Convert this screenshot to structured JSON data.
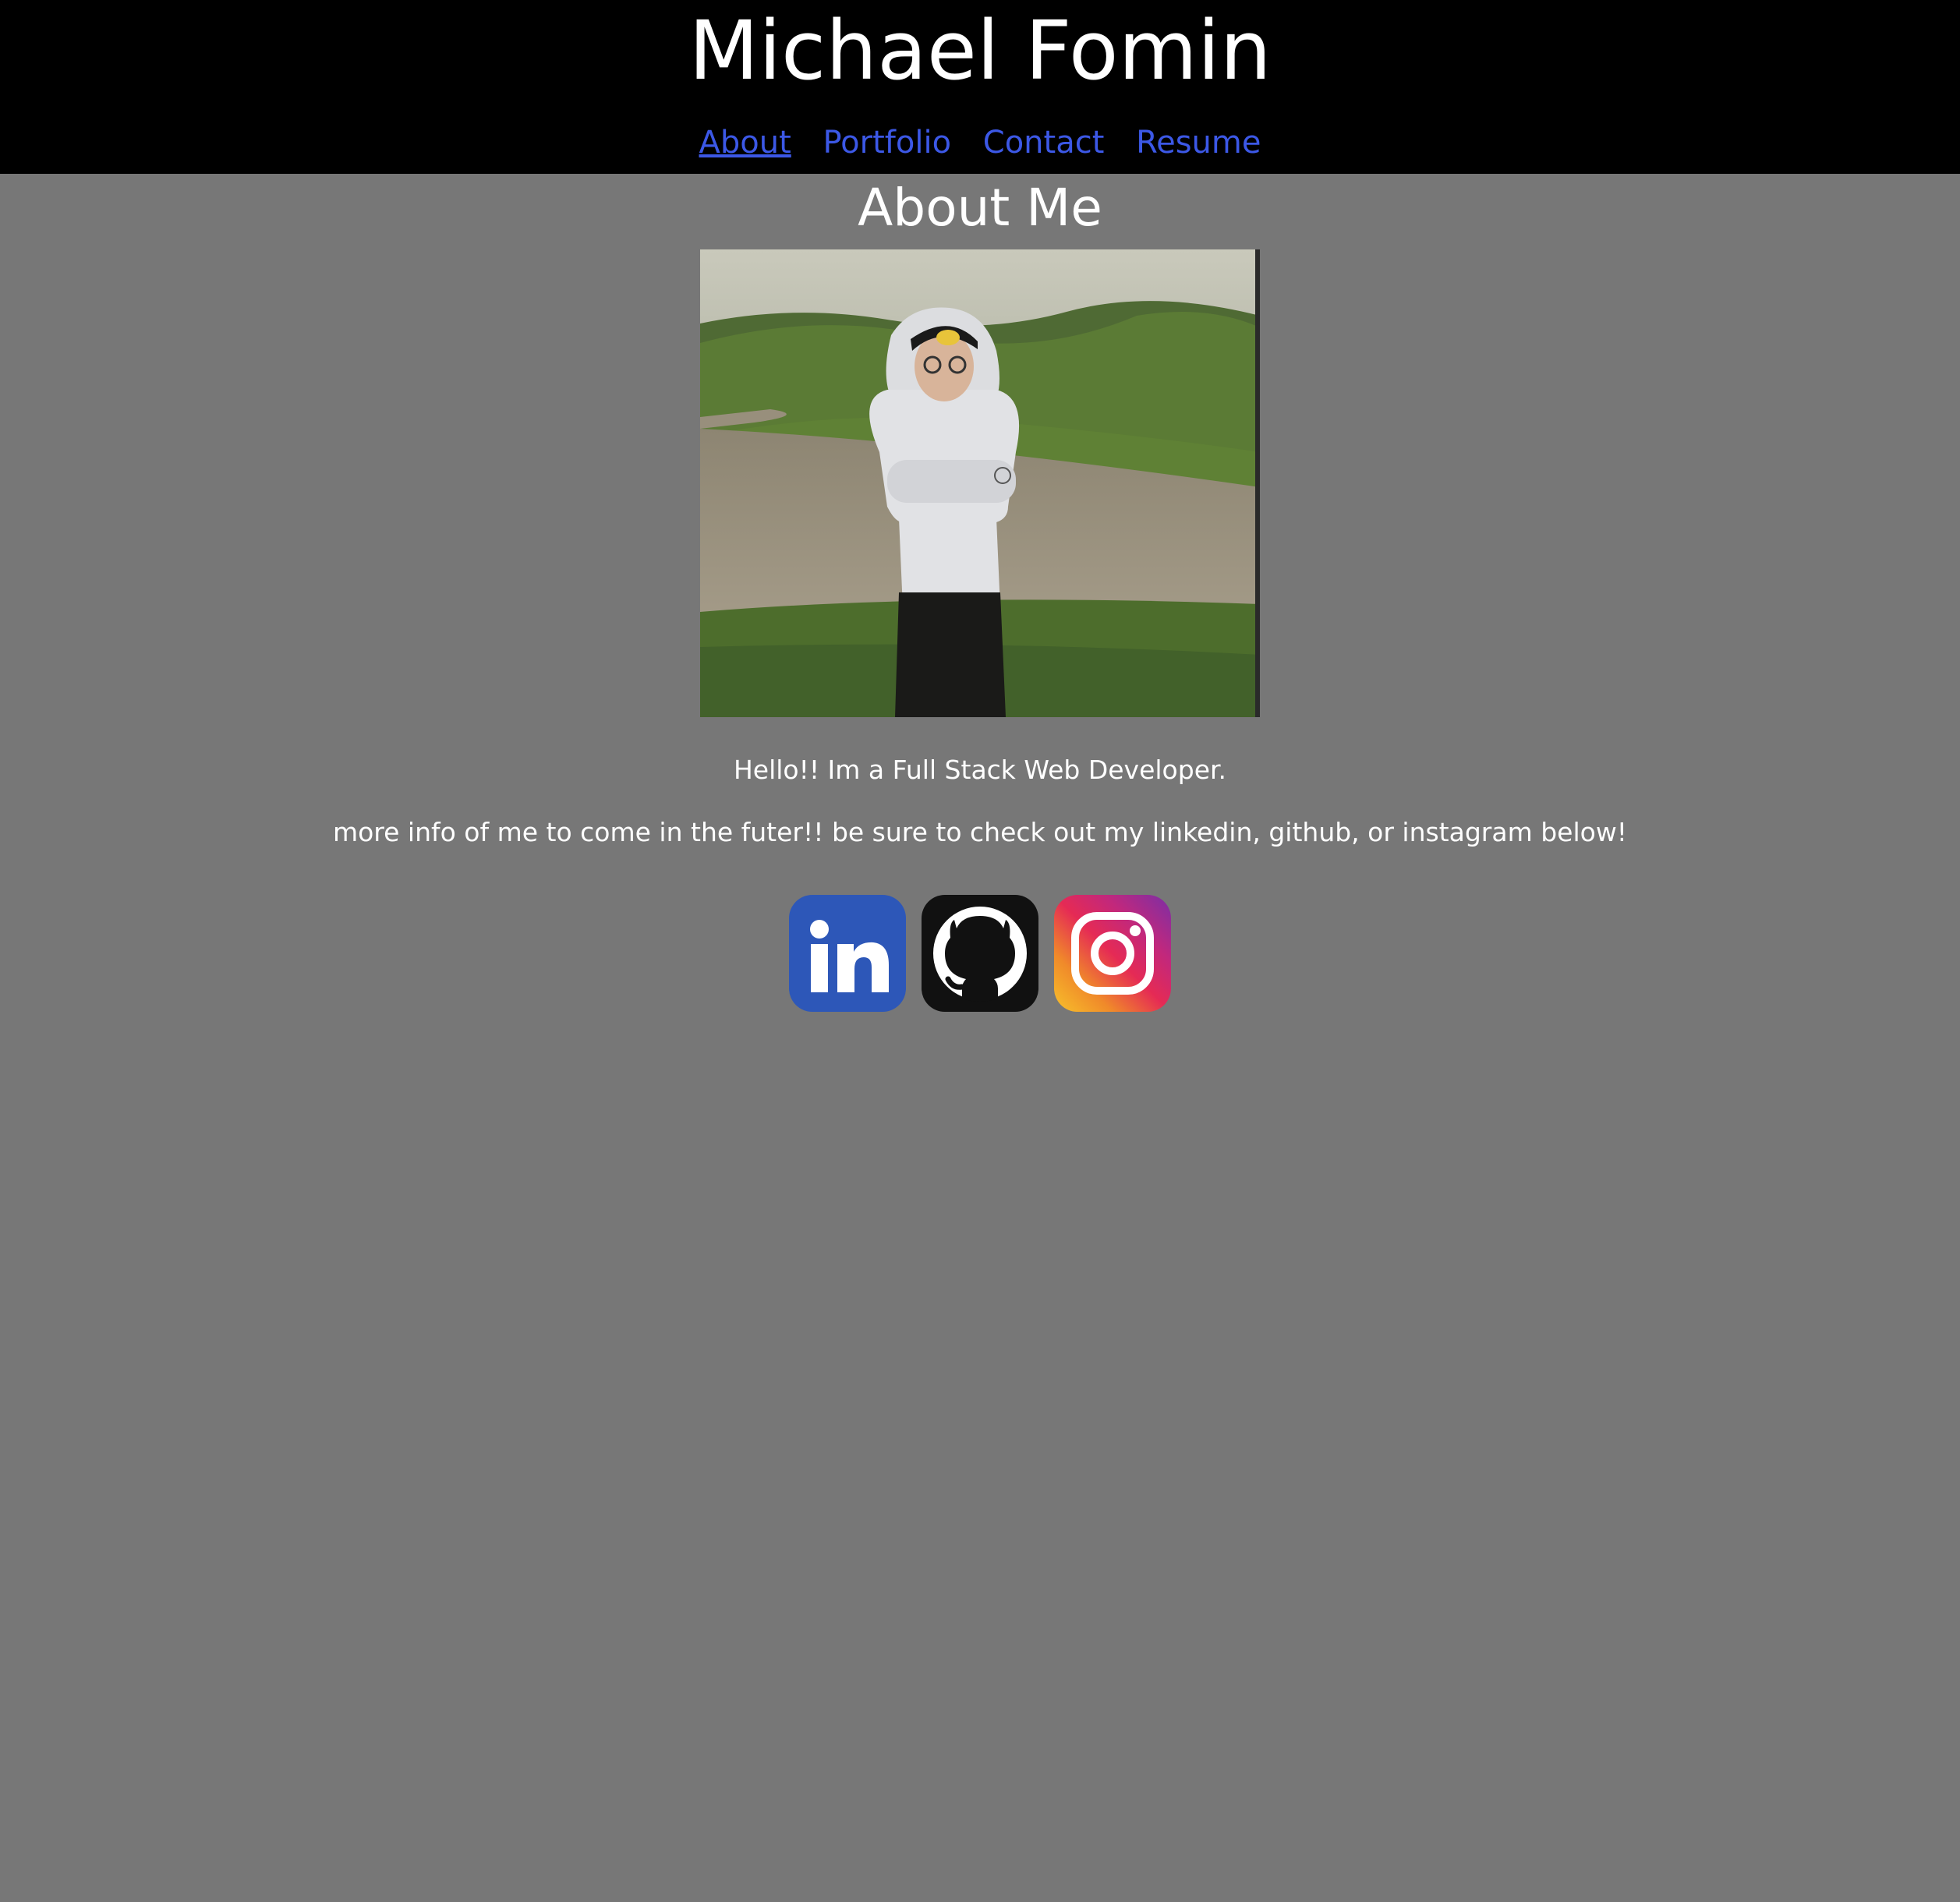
{
  "header": {
    "title": "Michael Fomin",
    "nav": [
      {
        "label": "About",
        "active": true
      },
      {
        "label": "Portfolio",
        "active": false
      },
      {
        "label": "Contact",
        "active": false
      },
      {
        "label": "Resume",
        "active": false
      }
    ]
  },
  "main": {
    "section_title": "About Me",
    "bio": {
      "line1": "Hello!! Im a Full Stack Web Developer.",
      "line2": "more info of me to come in the futer!! be sure to check out my linkedin, github, or instagram below!"
    },
    "socials": [
      {
        "icon": "linkedin-icon",
        "color": "#2d57b8"
      },
      {
        "icon": "github-icon",
        "color": "#111111"
      },
      {
        "icon": "instagram-icon",
        "color": "#e52a55"
      }
    ]
  },
  "colors": {
    "page_background": "#777777",
    "header_background": "#000000",
    "link": "#3c58e6",
    "text": "#ffffff"
  }
}
